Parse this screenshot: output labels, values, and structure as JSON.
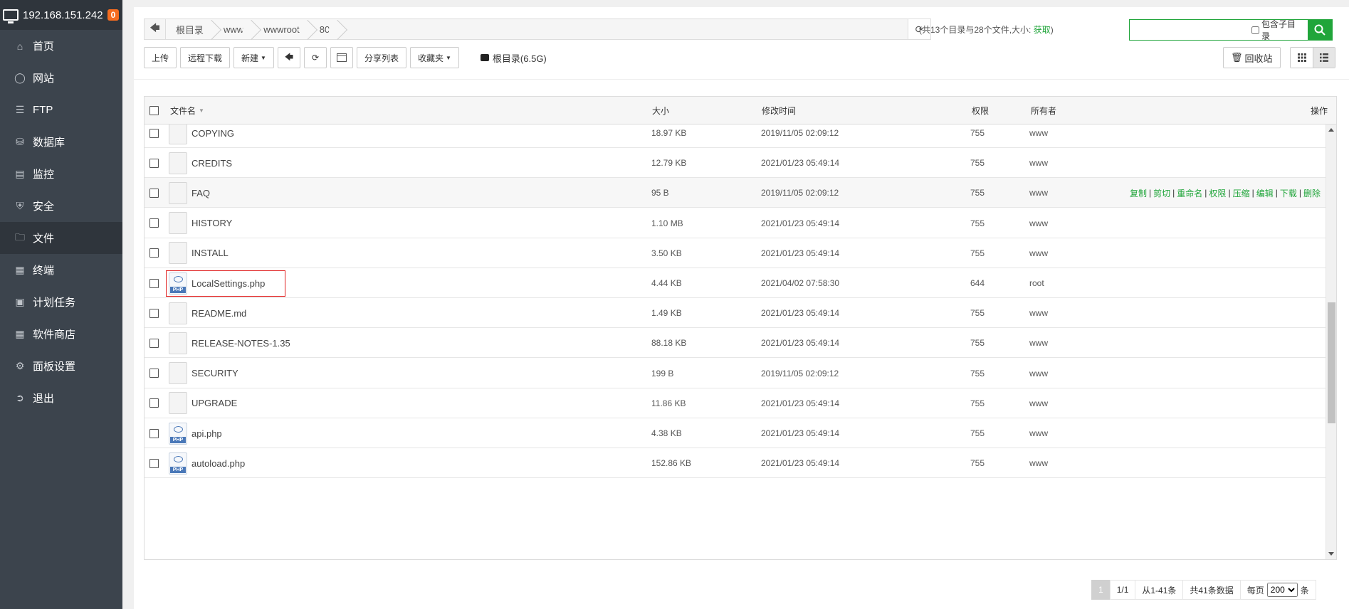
{
  "sidebar": {
    "host": "192.168.151.242",
    "badge": "0",
    "items": [
      {
        "label": "首页",
        "icon": "home-icon"
      },
      {
        "label": "网站",
        "icon": "globe-icon"
      },
      {
        "label": "FTP",
        "icon": "ftp-icon"
      },
      {
        "label": "数据库",
        "icon": "database-icon"
      },
      {
        "label": "监控",
        "icon": "monitor-icon"
      },
      {
        "label": "安全",
        "icon": "shield-icon"
      },
      {
        "label": "文件",
        "icon": "folder-icon"
      },
      {
        "label": "终端",
        "icon": "terminal-icon"
      },
      {
        "label": "计划任务",
        "icon": "calendar-icon"
      },
      {
        "label": "软件商店",
        "icon": "apps-icon"
      },
      {
        "label": "面板设置",
        "icon": "gear-icon"
      },
      {
        "label": "退出",
        "icon": "logout-icon"
      }
    ],
    "active_index": 6
  },
  "breadcrumb": [
    "根目录",
    "www",
    "wwwroot",
    "80"
  ],
  "summary": {
    "text": "(共13个目录与28个文件,大小:",
    "link": "获取",
    "close": ")"
  },
  "search": {
    "placeholder": "",
    "subdir_label": "包含子目录"
  },
  "toolbar": {
    "upload": "上传",
    "remote_download": "远程下载",
    "new": "新建",
    "share_list": "分享列表",
    "favorites": "收藏夹",
    "disk": "根目录(6.5G)",
    "recycle": "回收站"
  },
  "table": {
    "headers": {
      "name": "文件名",
      "size": "大小",
      "mtime": "修改时间",
      "perm": "权限",
      "owner": "所有者",
      "ops": "操作"
    },
    "rows": [
      {
        "name": "COPYING",
        "size": "18.97 KB",
        "mtime": "2019/11/05 02:09:12",
        "perm": "755",
        "owner": "www",
        "type": "file"
      },
      {
        "name": "CREDITS",
        "size": "12.79 KB",
        "mtime": "2021/01/23 05:49:14",
        "perm": "755",
        "owner": "www",
        "type": "file"
      },
      {
        "name": "FAQ",
        "size": "95 B",
        "mtime": "2019/11/05 02:09:12",
        "perm": "755",
        "owner": "www",
        "type": "file",
        "hover": true
      },
      {
        "name": "HISTORY",
        "size": "1.10 MB",
        "mtime": "2021/01/23 05:49:14",
        "perm": "755",
        "owner": "www",
        "type": "file"
      },
      {
        "name": "INSTALL",
        "size": "3.50 KB",
        "mtime": "2021/01/23 05:49:14",
        "perm": "755",
        "owner": "www",
        "type": "file"
      },
      {
        "name": "LocalSettings.php",
        "size": "4.44 KB",
        "mtime": "2021/04/02 07:58:30",
        "perm": "644",
        "owner": "root",
        "type": "php",
        "selected": true
      },
      {
        "name": "README.md",
        "size": "1.49 KB",
        "mtime": "2021/01/23 05:49:14",
        "perm": "755",
        "owner": "www",
        "type": "file"
      },
      {
        "name": "RELEASE-NOTES-1.35",
        "size": "88.18 KB",
        "mtime": "2021/01/23 05:49:14",
        "perm": "755",
        "owner": "www",
        "type": "file"
      },
      {
        "name": "SECURITY",
        "size": "199 B",
        "mtime": "2019/11/05 02:09:12",
        "perm": "755",
        "owner": "www",
        "type": "file"
      },
      {
        "name": "UPGRADE",
        "size": "11.86 KB",
        "mtime": "2021/01/23 05:49:14",
        "perm": "755",
        "owner": "www",
        "type": "file"
      },
      {
        "name": "api.php",
        "size": "4.38 KB",
        "mtime": "2021/01/23 05:49:14",
        "perm": "755",
        "owner": "www",
        "type": "php"
      },
      {
        "name": "autoload.php",
        "size": "152.86 KB",
        "mtime": "2021/01/23 05:49:14",
        "perm": "755",
        "owner": "www",
        "type": "php"
      }
    ],
    "row_ops": [
      "复制",
      "剪切",
      "重命名",
      "权限",
      "压缩",
      "编辑",
      "下载",
      "删除"
    ]
  },
  "pager": {
    "current": "1",
    "pages": "1/1",
    "range": "从1-41条",
    "total": "共41条数据",
    "per_page_label": "每页",
    "per_page": "200",
    "unit": "条"
  },
  "colors": {
    "accent": "#20a53a",
    "sidebar": "#3c444d",
    "badge": "#f56c1f",
    "selection": "#e02020"
  }
}
